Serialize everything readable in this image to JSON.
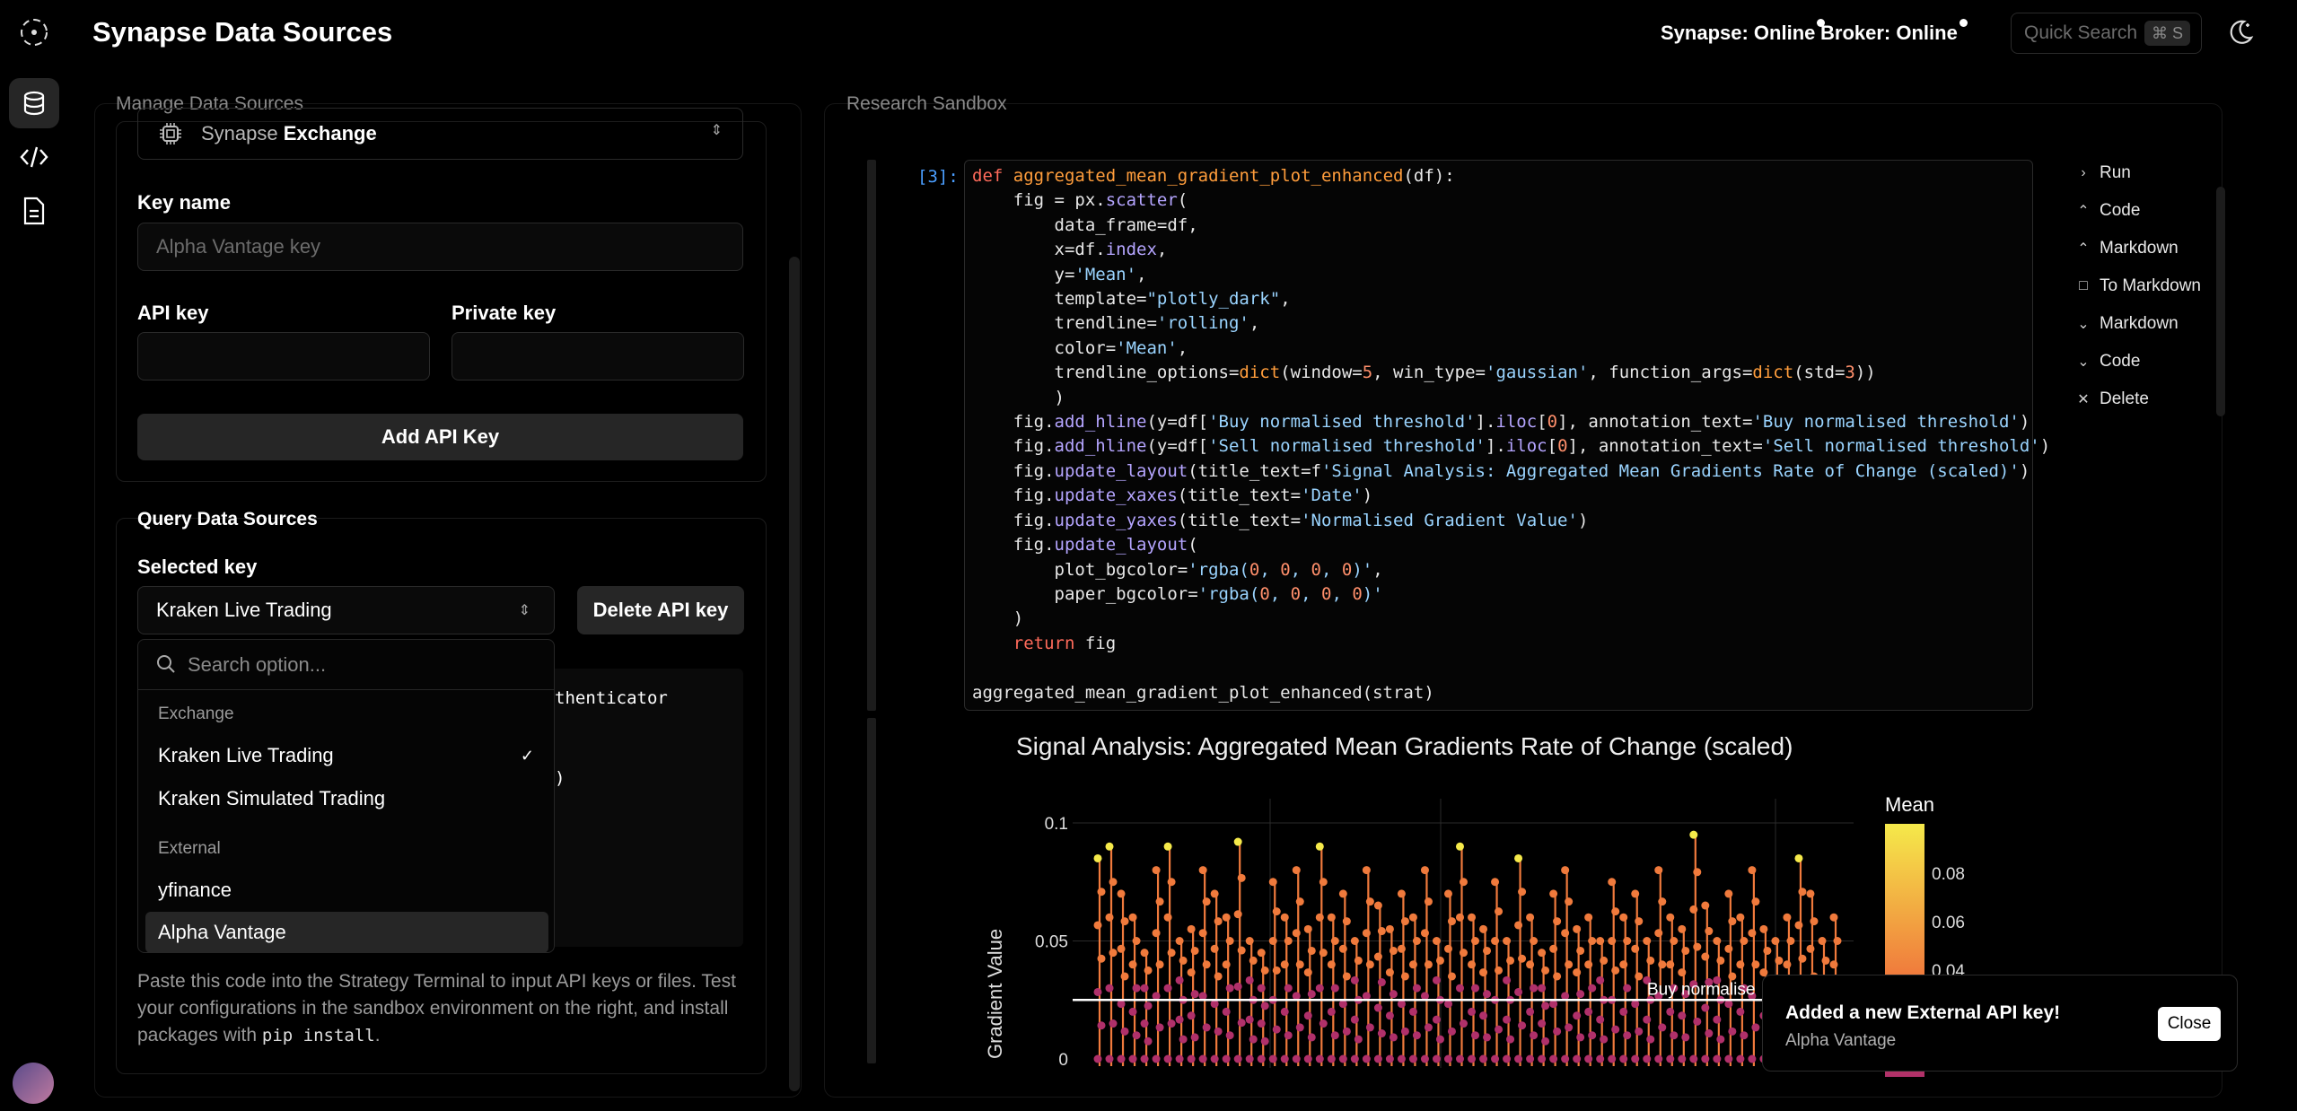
{
  "app": {
    "title": "Synapse Data Sources"
  },
  "status": {
    "synapse": "Synapse: Online",
    "broker": "Broker: Online"
  },
  "search": {
    "placeholder": "Quick Search",
    "shortcut": "⌘ S"
  },
  "left_panel": {
    "title": "Manage Data Sources",
    "exchange_select": {
      "prefix": "Synapse",
      "value": "Exchange"
    },
    "key_name_label": "Key name",
    "key_name_placeholder": "Alpha Vantage key",
    "api_key_label": "API key",
    "private_key_label": "Private key",
    "add_button": "Add API Key",
    "query_title": "Query Data Sources",
    "selected_key_label": "Selected key",
    "selected_key_value": "Kraken Live Trading",
    "delete_button": "Delete API key",
    "code_fragment_1": "thenticator",
    "code_fragment_2": ")",
    "help_text_1": "Paste this code into the Strategy Terminal to input API keys or files. Test your configurations in the sandbox environment on the right, and install packages with ",
    "help_code": "pip install",
    "help_text_2": "."
  },
  "dropdown": {
    "search_placeholder": "Search option...",
    "group_exchange": "Exchange",
    "group_external": "External",
    "items": [
      "Kraken Live Trading",
      "Kraken Simulated Trading",
      "yfinance",
      "Alpha Vantage"
    ],
    "checked": "Kraken Live Trading",
    "highlighted": "Alpha Vantage"
  },
  "right_panel": {
    "title": "Research Sandbox",
    "prompt": "[3]:",
    "toolbar": [
      "Run",
      "Code",
      "Markdown",
      "To Markdown",
      "Markdown",
      "Code",
      "Delete"
    ],
    "toolbar_icons": [
      "chevron-right-icon",
      "chevron-up-icon",
      "chevron-up-icon",
      "square-icon",
      "chevron-down-icon",
      "chevron-down-icon",
      "close-icon"
    ]
  },
  "code_lines": [
    "def aggregated_mean_gradient_plot_enhanced(df):",
    "    fig = px.scatter(",
    "        data_frame=df,",
    "        x=df.index,",
    "        y='Mean',",
    "        template=\"plotly_dark\",",
    "        trendline='rolling',",
    "        color='Mean',",
    "        trendline_options=dict(window=5, win_type='gaussian', function_args=dict(std=3))",
    "        )",
    "    fig.add_hline(y=df['Buy normalised threshold'].iloc[0], annotation_text='Buy normalised threshold')",
    "    fig.add_hline(y=df['Sell normalised threshold'].iloc[0], annotation_text='Sell normalised threshold')",
    "    fig.update_layout(title_text=f'Signal Analysis: Aggregated Mean Gradients Rate of Change (scaled)')",
    "    fig.update_xaxes(title_text='Date')",
    "    fig.update_yaxes(title_text='Normalised Gradient Value')",
    "    fig.update_layout(",
    "        plot_bgcolor='rgba(0, 0, 0, 0)',",
    "        paper_bgcolor='rgba(0, 0, 0, 0)'",
    "    )",
    "    return fig",
    "",
    "aggregated_mean_gradient_plot_enhanced(strat)"
  ],
  "chart_data": {
    "type": "scatter",
    "title": "Signal Analysis: Aggregated Mean Gradients Rate of Change (scaled)",
    "ylabel": "Gradient Value",
    "ylim": [
      0,
      0.1
    ],
    "yticks": [
      "0.1",
      "0.05",
      "0"
    ],
    "colorbar_title": "Mean",
    "colorbar_ticks": [
      "0.08",
      "0.06",
      "0.04"
    ],
    "hline_value": 0.025,
    "hline_label": "Buy normalise",
    "colors": {
      "low": "#b0306a",
      "mid": "#f07a3c",
      "high": "#f5e94a"
    },
    "series_peaks": [
      0.085,
      0.09,
      0.07,
      0.06,
      0.045,
      0.08,
      0.09,
      0.05,
      0.055,
      0.08,
      0.07,
      0.06,
      0.092,
      0.05,
      0.045,
      0.075,
      0.06,
      0.08,
      0.055,
      0.09,
      0.06,
      0.07,
      0.05,
      0.08,
      0.065,
      0.055,
      0.07,
      0.06,
      0.08,
      0.05,
      0.07,
      0.09,
      0.06,
      0.055,
      0.075,
      0.05,
      0.085,
      0.06,
      0.045,
      0.07,
      0.08,
      0.055,
      0.06,
      0.05,
      0.075,
      0.06,
      0.07,
      0.05,
      0.08,
      0.06,
      0.055,
      0.095,
      0.065,
      0.05,
      0.07,
      0.06,
      0.08,
      0.055,
      0.05,
      0.06,
      0.085,
      0.07,
      0.05,
      0.06
    ]
  },
  "toast": {
    "title": "Added a new External API key!",
    "subtitle": "Alpha Vantage",
    "close": "Close"
  }
}
